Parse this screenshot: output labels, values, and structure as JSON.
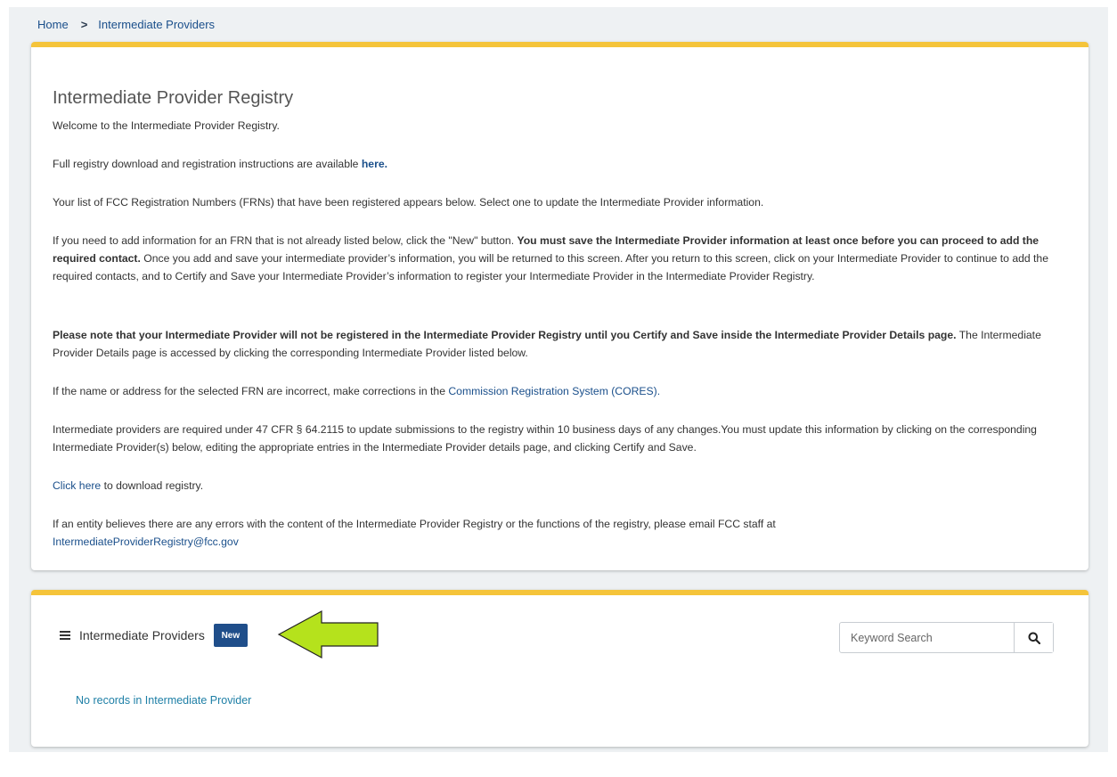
{
  "breadcrumb": {
    "home": "Home",
    "separator": ">",
    "current": "Intermediate Providers"
  },
  "registry": {
    "title": "Intermediate Provider Registry",
    "welcome": "Welcome to the Intermediate Provider Registry.",
    "p_download_prefix": "Full registry download and registration instructions are available ",
    "p_download_link": "here.",
    "p_list": "Your list of FCC Registration Numbers (FRNs) that have been registered appears below. Select one to update the Intermediate Provider information.",
    "p_add_1": "If you need to add information for an FRN that is not already listed below, click the \"New\" button. ",
    "p_add_bold": "You must save the Intermediate Provider information at least once before you can proceed to add the required contact.",
    "p_add_2": " Once you add and save your intermediate provider’s information, you will be returned to this screen. After you return to this screen, click on your Intermediate Provider to continue to add the required contacts, and to Certify and Save your Intermediate Provider’s information to register your Intermediate Provider in the Intermediate Provider Registry.",
    "p_note_bold": "Please note that your Intermediate Provider will not be registered in the Intermediate Provider Registry until you Certify and Save inside the Intermediate Provider Details page.",
    "p_note_rest": "The Intermediate Provider Details page is accessed by clicking the corresponding Intermediate Provider listed below.",
    "p_cores_prefix": "If the name or address for the selected FRN are incorrect, make corrections in the ",
    "p_cores_link": "Commission Registration System (CORES).",
    "p_cfr": "Intermediate providers are required under 47 CFR § 64.2115 to update submissions to the registry within 10 business days of any changes.You must update this information by clicking on the corresponding Intermediate Provider(s) below, editing the appropriate entries in the Intermediate Provider details page, and clicking Certify and Save.",
    "p_click_link": "Click here",
    "p_click_rest": " to download registry.",
    "p_errors": "If an entity believes there are any errors with the content of the Intermediate Provider Registry or the functions of the registry, please email FCC staff at",
    "p_email": "IntermediateProviderRegistry@fcc.gov"
  },
  "providers": {
    "title": "Intermediate Providers",
    "new_label": "New",
    "search_placeholder": "Keyword Search",
    "empty_message": "No records in Intermediate Provider"
  },
  "colors": {
    "accent_bar": "#f5c43a",
    "link": "#1a4f8b",
    "button": "#1f4e8a",
    "arrow": "#b5e21c"
  },
  "icons": {
    "menu": "menu-icon",
    "search": "search-icon",
    "arrow": "arrow-annotation-icon"
  }
}
